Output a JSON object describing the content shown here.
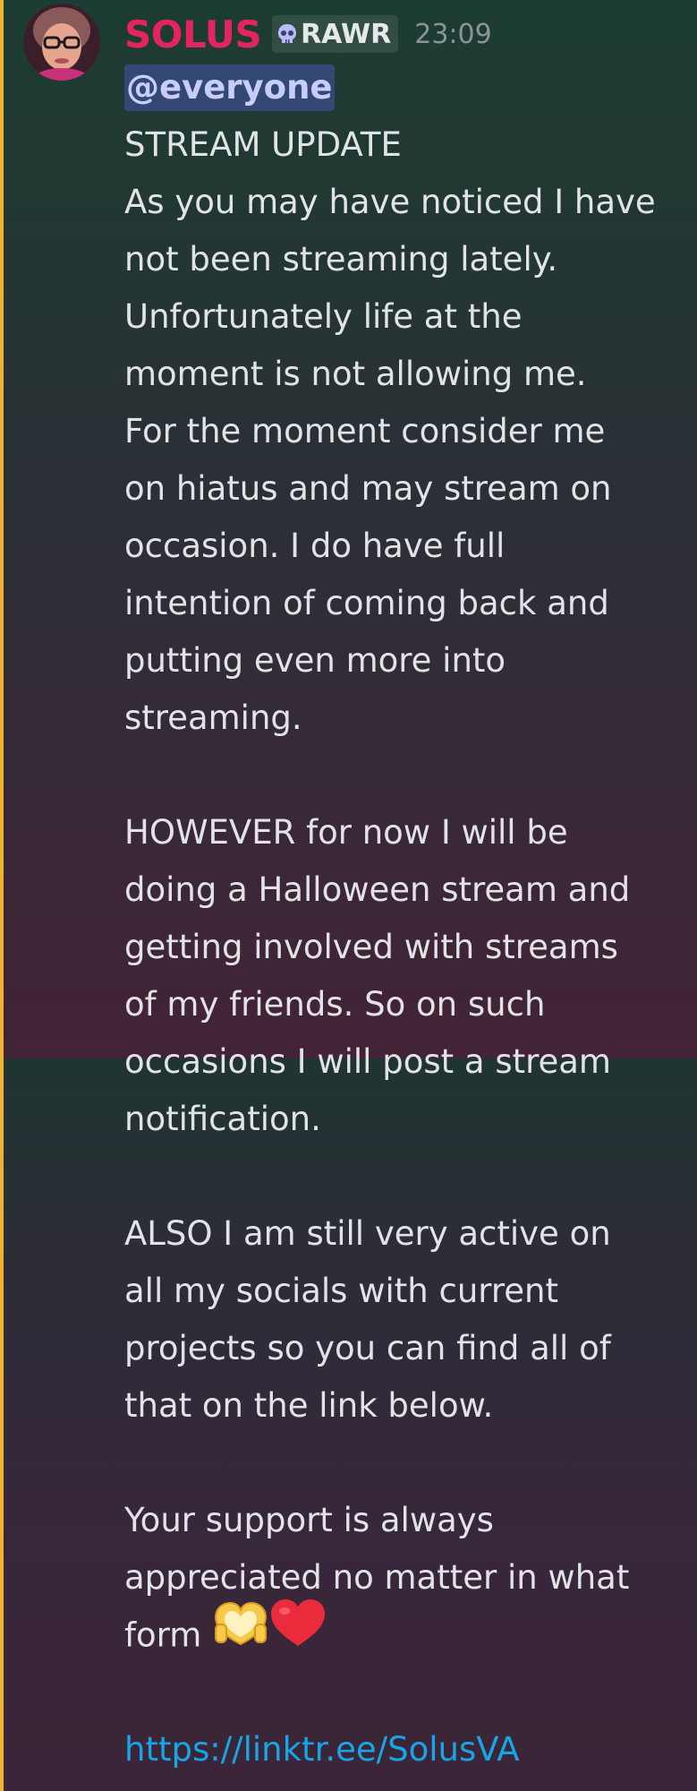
{
  "message": {
    "author": "SOLUS",
    "role_tag": {
      "icon": "skull-icon",
      "label": "RAWR"
    },
    "timestamp": "23:09",
    "mention": "@everyone",
    "lines": [
      "STREAM UPDATE",
      "As you may have noticed I have",
      "not been streaming lately.",
      "Unfortunately life at the",
      "moment is not allowing me.",
      "For the moment consider me",
      "on hiatus and may stream on",
      "occasion. I do have full",
      "intention of coming back and",
      "putting even more into",
      "streaming.",
      "",
      "HOWEVER for now I will be",
      "doing a Halloween stream and",
      "getting involved with streams",
      "of my friends. So on such",
      "occasions I will post a stream",
      "notification.",
      "",
      "ALSO I am still very active on",
      "all my socials with current",
      "projects so you can find all of",
      "that on the link below.",
      "",
      "Your support is always",
      "appreciated no matter in what"
    ],
    "last_line_text": "form ",
    "emojis": [
      "heart-hands-icon",
      "red-heart-icon"
    ],
    "link": "https://linktr.ee/SolusVA"
  },
  "colors": {
    "username": "#e3245f",
    "accent_bar": "#f0b232",
    "link": "#18a5e8",
    "mention_bg": "#5865f2"
  }
}
